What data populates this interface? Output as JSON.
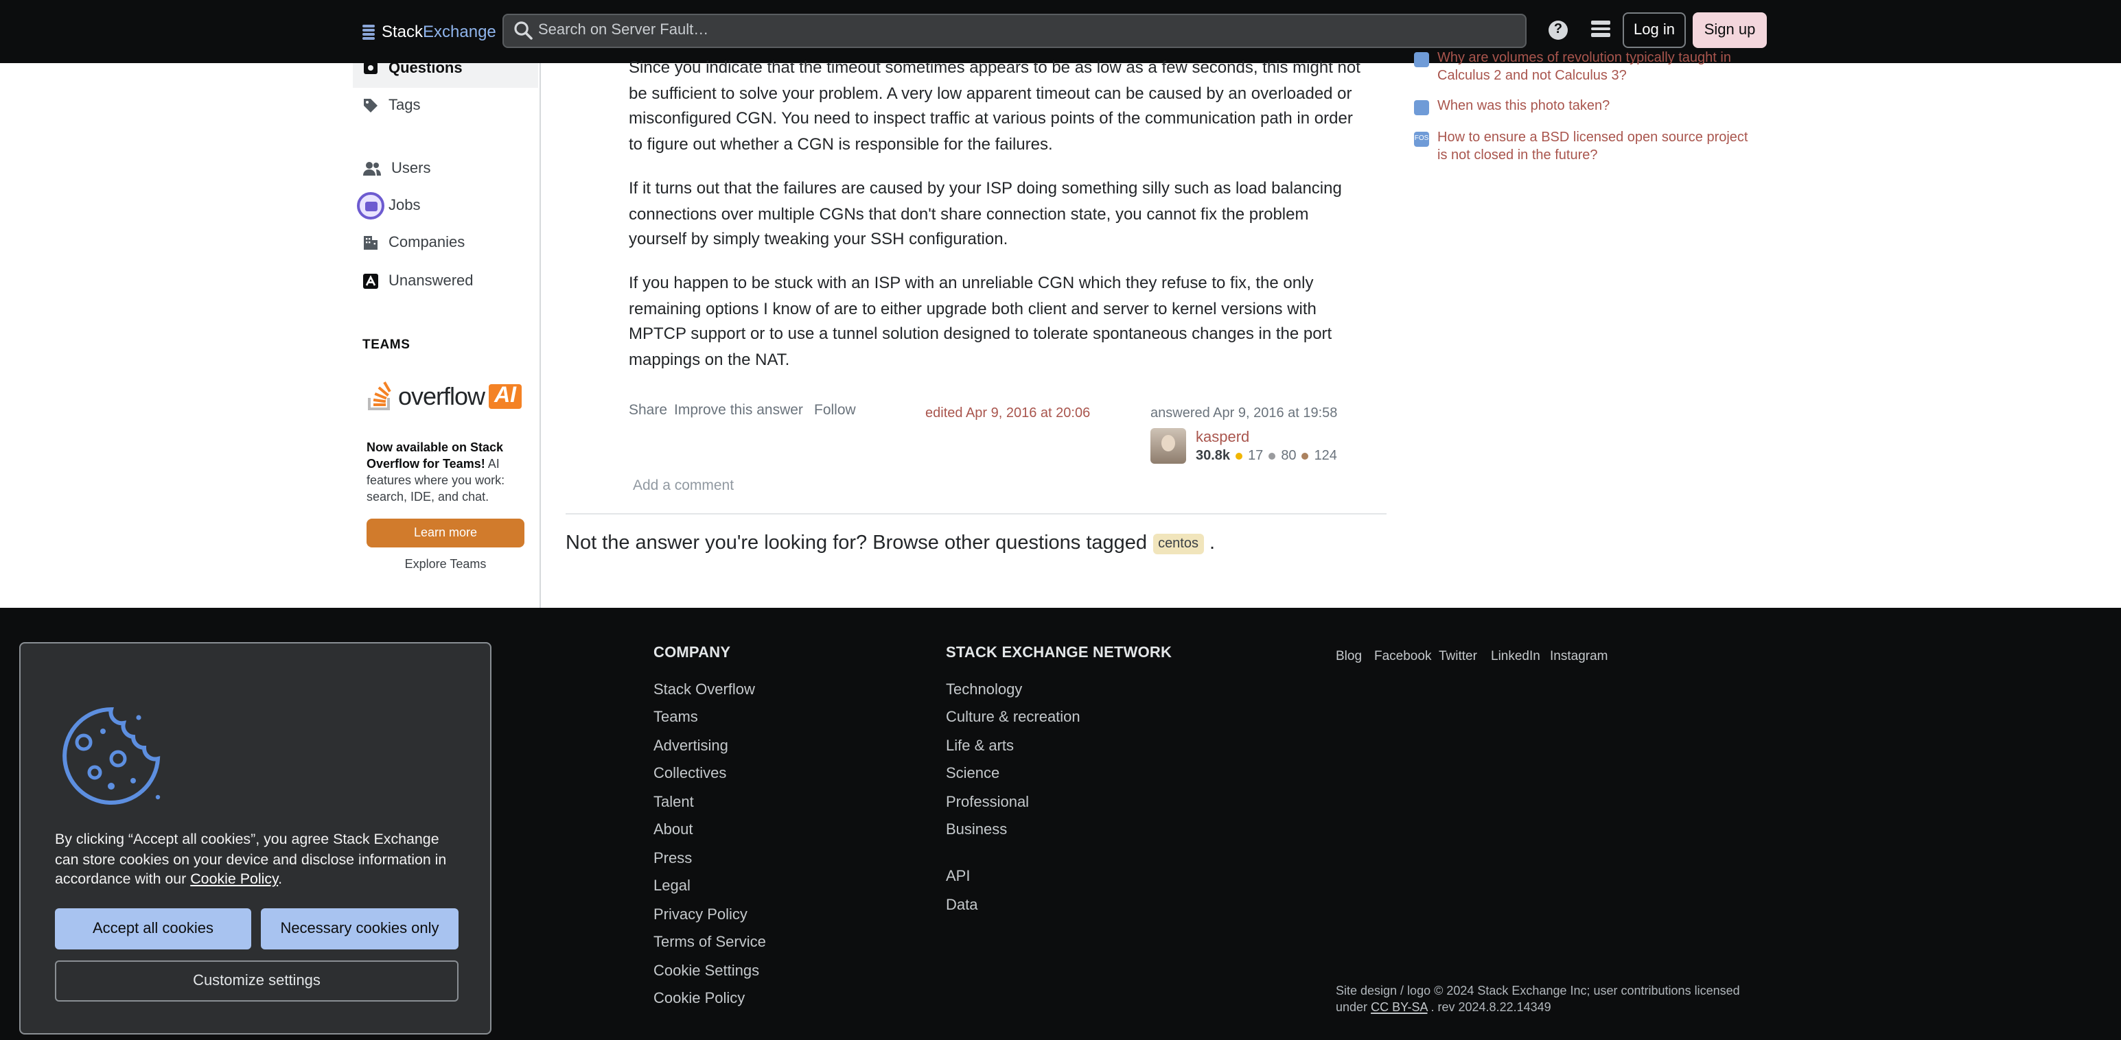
{
  "header": {
    "logo_stack": "Stack",
    "logo_exchange": "Exchange",
    "search_placeholder": "Search on Server Fault…",
    "help_label": "?",
    "login_label": "Log in",
    "signup_label": "Sign up"
  },
  "sidebar": {
    "items": [
      {
        "label": "Questions",
        "icon": "questions-icon",
        "active": true
      },
      {
        "label": "Tags",
        "icon": "tag-icon"
      },
      {
        "label": "Users",
        "icon": "users-icon"
      },
      {
        "label": "Jobs",
        "icon": "briefcase-icon"
      },
      {
        "label": "Companies",
        "icon": "building-icon"
      },
      {
        "label": "Unanswered",
        "icon": "unanswered-icon"
      }
    ],
    "teams_heading": "TEAMS",
    "overflow_ai_word": "overflow",
    "overflow_ai_badge": "AI",
    "promo_bold": "Now available on Stack Overflow for Teams!",
    "promo_rest": " AI features where you work: search, IDE, and chat.",
    "learn_more_label": "Learn more",
    "explore_teams_label": "Explore Teams"
  },
  "answer": {
    "paragraphs": [
      "Since you indicate that the timeout sometimes appears to be as low as a few seconds, this might not be sufficient to solve your problem. A very low apparent timeout can be caused by an overloaded or misconfigured CGN. You need to inspect traffic at various points of the communication path in order to figure out whether a CGN is responsible for the failures.",
      "If it turns out that the failures are caused by your ISP doing something silly such as load balancing connections over multiple CGNs that don't share connection state, you cannot fix the problem yourself by simply tweaking your SSH configuration.",
      "If you happen to be stuck with an ISP with an unreliable CGN which they refuse to fix, the only remaining options I know of are to either upgrade both client and server to kernel versions with MPTCP support or to use a tunnel solution designed to tolerate spontaneous changes in the port mappings on the NAT."
    ],
    "share_label": "Share",
    "improve_label": "Improve this answer",
    "follow_label": "Follow",
    "edited_text": "edited Apr 9, 2016 at 20:06",
    "answered_text": "answered Apr 9, 2016 at 19:58",
    "user_name": "kasperd",
    "user_rep": "30.8k",
    "gold_badges": "17",
    "silver_badges": "80",
    "bronze_badges": "124",
    "add_comment_label": "Add a comment",
    "not_answer_text": "Not the answer you're looking for? Browse other questions tagged",
    "tag": "centos",
    "trailing_period": "."
  },
  "hot_questions": [
    {
      "label": "Why are volumes of revolution typically taught in Calculus 2 and not Calculus 3?",
      "site_abbr": ""
    },
    {
      "label": "When was this photo taken?",
      "site_abbr": ""
    },
    {
      "label": "How to ensure a BSD licensed open source project is not closed in the future?",
      "site_abbr": "FOS"
    }
  ],
  "footer": {
    "company_heading": "COMPANY",
    "company_links": [
      "Stack Overflow",
      "Teams",
      "Advertising",
      "Collectives",
      "Talent",
      "About",
      "Press",
      "Legal",
      "Privacy Policy",
      "Terms of Service",
      "Cookie Settings",
      "Cookie Policy"
    ],
    "network_heading": "STACK EXCHANGE NETWORK",
    "network_links": [
      "Technology",
      "Culture & recreation",
      "Life & arts",
      "Science",
      "Professional",
      "Business"
    ],
    "network_links2": [
      "API",
      "Data"
    ],
    "social_links": [
      "Blog",
      "Facebook",
      "Twitter",
      "LinkedIn",
      "Instagram"
    ],
    "copyright_line1": "Site design / logo © 2024 Stack Exchange Inc; user contributions licensed",
    "copyright_under": "under",
    "copyright_license": "CC BY-SA",
    "copyright_rev": ". rev 2024.8.22.14349"
  },
  "cookie_dialog": {
    "text_before": "By clicking “Accept all cookies”, you agree Stack Exchange can store cookies on your device and disclose information in accordance with our ",
    "policy_link": "Cookie Policy",
    "text_after": ".",
    "accept_label": "Accept all cookies",
    "necessary_label": "Necessary cookies only",
    "customize_label": "Customize settings"
  },
  "colors": {
    "topbar_bg": "#0c0d0e",
    "link_red": "#a9554d",
    "accent_orange": "#d17b2c",
    "cookie_button": "#a8c3f0",
    "tag_bg": "#f1e5bc"
  }
}
